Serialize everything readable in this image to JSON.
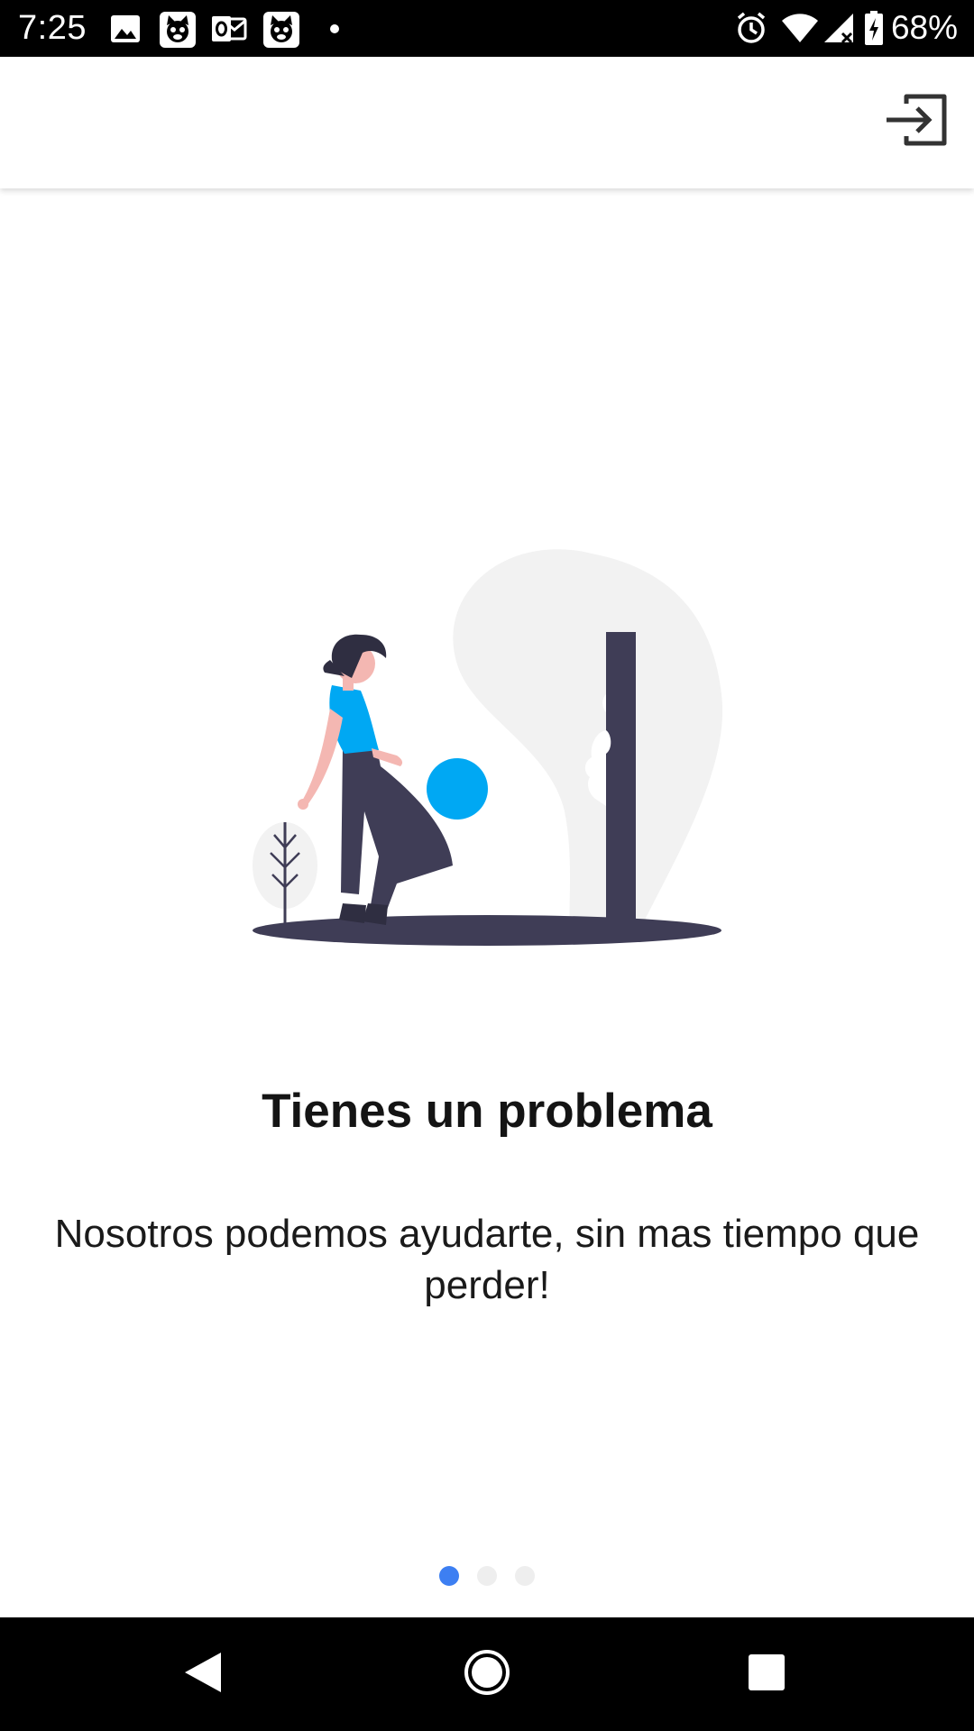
{
  "status_bar": {
    "time": "7:25",
    "battery_percent": "68%",
    "notification_icons": [
      "image-icon",
      "cat-app-icon",
      "outlook-icon",
      "cat-app-icon",
      "more-dot-icon"
    ],
    "system_icons": [
      "alarm-icon",
      "wifi-icon",
      "cellular-signal-icon",
      "battery-charging-icon"
    ]
  },
  "app_bar": {
    "action_icon": "login-icon"
  },
  "onboarding": {
    "title": "Tienes un problema",
    "description": "Nosotros podemos ayudarte, sin mas tiempo que perder!",
    "page_count": 3,
    "current_page": 1
  },
  "nav_bar": {
    "buttons": [
      "back-icon",
      "home-icon",
      "recents-icon"
    ]
  },
  "colors": {
    "accent_blue": "#00a8f3",
    "active_dot": "#3d7ff2",
    "inactive_dot": "#eeeeee",
    "dark_figure": "#3f3d56",
    "light_gray_shape": "#f2f2f2",
    "skin": "#f4b7b2"
  }
}
